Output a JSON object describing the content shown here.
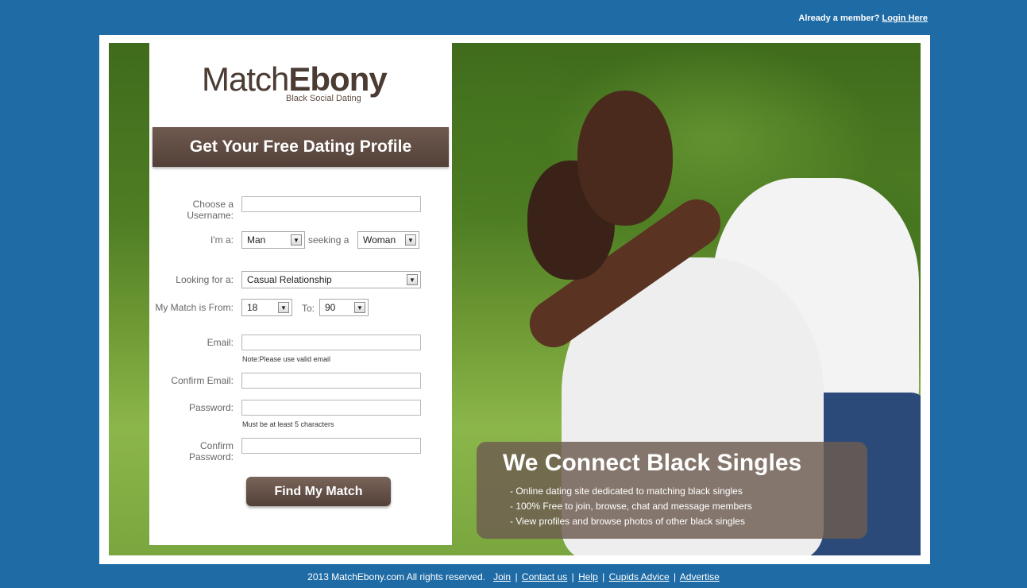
{
  "header": {
    "member_text": "Already a member?",
    "login_link": "Login Here"
  },
  "logo": {
    "light": "Match",
    "bold": "Ebony",
    "tagline": "Black Social Dating"
  },
  "form": {
    "banner": "Get Your Free Dating Profile",
    "username_label": "Choose a Username:",
    "iam_label": "I'm a:",
    "iam_value": "Man",
    "seeking_label": "seeking a",
    "seeking_value": "Woman",
    "looking_label": "Looking for a:",
    "looking_value": "Casual Relationship",
    "match_from_label": "My Match is From:",
    "age_from": "18",
    "to_label": "To:",
    "age_to": "90",
    "email_label": "Email:",
    "email_note": "Note:Please use valid email",
    "confirm_email_label": "Confirm Email:",
    "password_label": "Password:",
    "password_note": "Must be at least 5 characters",
    "confirm_password_label": "Confirm Password:",
    "submit_label": "Find My Match"
  },
  "promo": {
    "title": "We Connect Black Singles",
    "bullets": [
      "- Online dating site dedicated to matching black singles",
      "- 100% Free to join, browse, chat and message members",
      "- View profiles and browse photos of other black singles"
    ]
  },
  "footer": {
    "copyright": "2013 MatchEbony.com  All rights reserved.",
    "links": [
      "Join",
      "Contact us",
      "Help",
      "Cupids Advice",
      "Advertise"
    ],
    "separator": "|"
  }
}
